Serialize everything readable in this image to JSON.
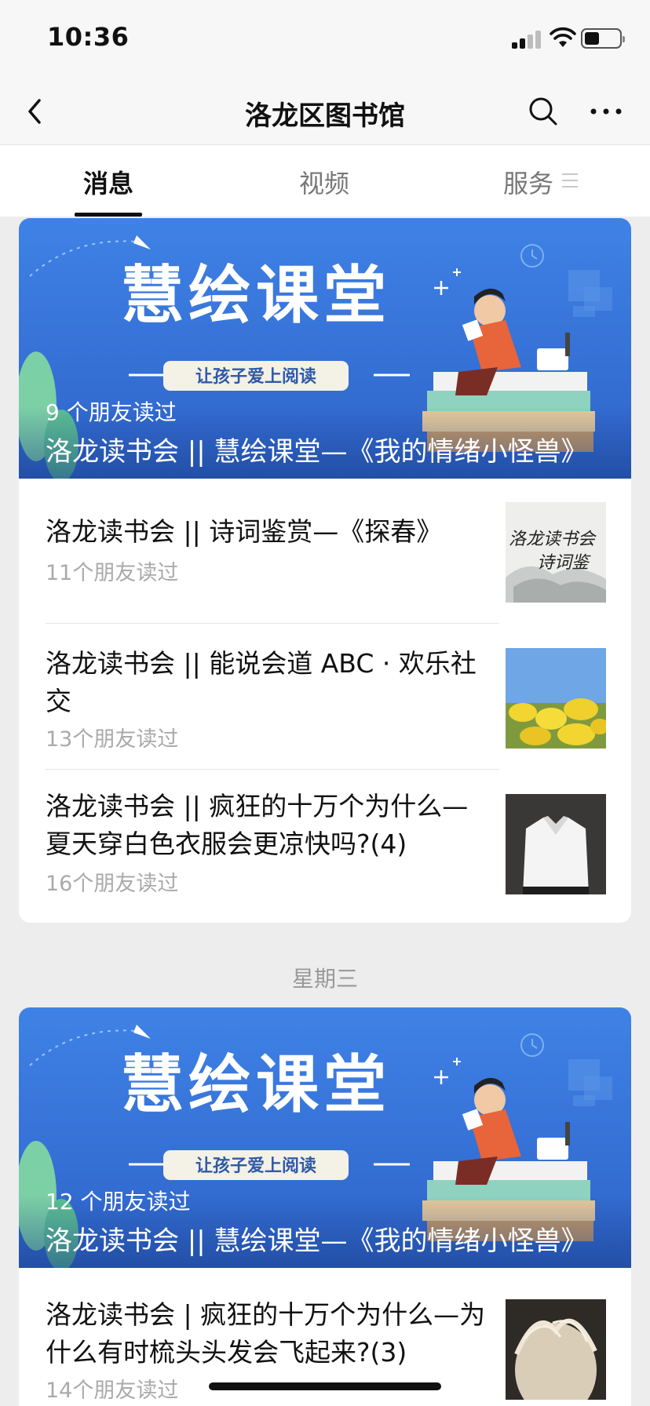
{
  "status_bar": {
    "time": "10:36"
  },
  "nav": {
    "title": "洛龙区图书馆"
  },
  "tabs": [
    {
      "label": "消息",
      "active": true
    },
    {
      "label": "视频",
      "active": false
    },
    {
      "label": "服务",
      "active": false
    }
  ],
  "banner": {
    "heading": "慧绘课堂",
    "tagline": "让孩子爱上阅读"
  },
  "feed": {
    "group1": {
      "banner_readcount": "9 个朋友读过",
      "banner_title": "洛龙读书会 || 慧绘课堂—《我的情绪小怪兽》",
      "articles": [
        {
          "title": "洛龙读书会 || 诗词鉴赏—《探春》",
          "readcount": "11个朋友读过",
          "thumb_text": [
            "洛龙读书会",
            "诗词鉴"
          ]
        },
        {
          "title": "洛龙读书会 || 能说会道 ABC · 欢乐社交",
          "readcount": "13个朋友读过"
        },
        {
          "title": "洛龙读书会 || 疯狂的十万个为什么—夏天穿白色衣服会更凉快吗?(4)",
          "readcount": "16个朋友读过"
        }
      ]
    },
    "day_label": "星期三",
    "group2": {
      "banner_readcount": "12 个朋友读过",
      "banner_title": "洛龙读书会 || 慧绘课堂—《我的情绪小怪兽》",
      "articles": [
        {
          "title": "洛龙读书会 | 疯狂的十万个为什么—为什么有时梳头头发会飞起来?(3)",
          "readcount": "14个朋友读过"
        }
      ]
    }
  },
  "colors": {
    "banner_blue": "#3b7be0",
    "accent_orange": "#e8643a"
  }
}
